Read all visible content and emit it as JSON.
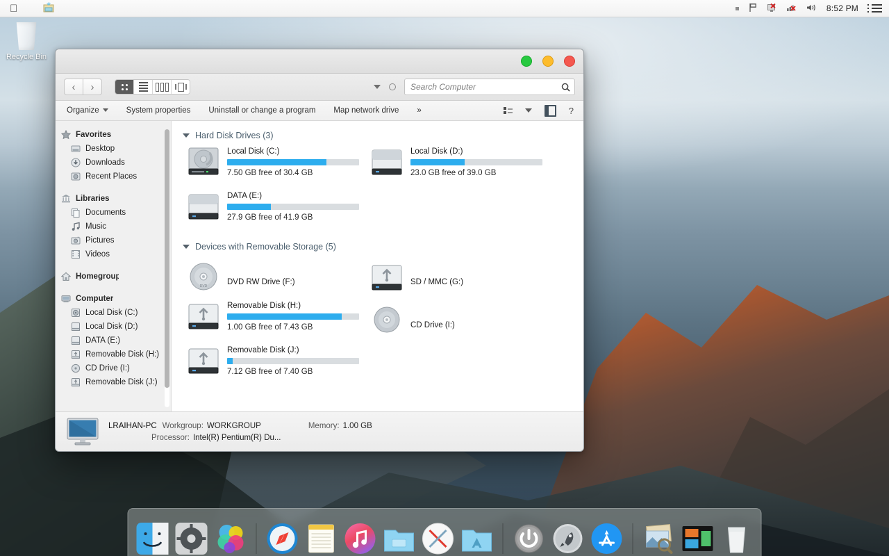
{
  "menubar": {
    "apple_icon": "apple-logo",
    "app_icon": "folder-app-icon",
    "status_icons": [
      "small-square-icon",
      "flag-icon",
      "action-center-alert-icon",
      "network-disconnected-icon",
      "volume-icon"
    ],
    "clock": "8:52 PM",
    "menu_icon": "hamburger-menu-icon"
  },
  "desktop": {
    "icons": [
      {
        "label": "Recycle Bin",
        "icon": "trash-can-icon"
      }
    ]
  },
  "window": {
    "traffic_lights": [
      {
        "name": "maximize",
        "color": "#28c941"
      },
      {
        "name": "minimize",
        "color": "#fdbc2c"
      },
      {
        "name": "close",
        "color": "#f4584f"
      }
    ],
    "nav": {
      "back_label": "‹",
      "forward_label": "›",
      "views": [
        {
          "name": "icon-view",
          "icon": "grid-icon",
          "active": true
        },
        {
          "name": "list-view",
          "icon": "list-icon",
          "active": false
        },
        {
          "name": "column-view",
          "icon": "columns-icon",
          "active": false
        },
        {
          "name": "gallery-view",
          "icon": "coverflow-icon",
          "active": false
        }
      ],
      "arrange_icon": "caret-down-icon",
      "action_icon": "circle-icon"
    },
    "search": {
      "placeholder": "Search Computer",
      "value": "",
      "icon": "search-icon"
    },
    "commandbar": {
      "items": [
        {
          "label": "Organize",
          "has_caret": true
        },
        {
          "label": "System properties",
          "has_caret": false
        },
        {
          "label": "Uninstall or change a program",
          "has_caret": false
        },
        {
          "label": "Map network drive",
          "has_caret": false
        },
        {
          "label": "»",
          "has_caret": false
        }
      ],
      "right_icons": [
        {
          "name": "change-view-icon"
        },
        {
          "name": "caret-down-icon"
        },
        {
          "name": "preview-pane-icon"
        },
        {
          "name": "help-icon",
          "glyph": "?"
        }
      ]
    },
    "sidebar": {
      "groups": [
        {
          "header": {
            "label": "Favorites",
            "icon": "star-icon"
          },
          "items": [
            {
              "label": "Desktop",
              "icon": "desktop-icon"
            },
            {
              "label": "Downloads",
              "icon": "downloads-icon"
            },
            {
              "label": "Recent Places",
              "icon": "recent-places-icon"
            }
          ]
        },
        {
          "header": {
            "label": "Libraries",
            "icon": "library-icon"
          },
          "items": [
            {
              "label": "Documents",
              "icon": "documents-icon"
            },
            {
              "label": "Music",
              "icon": "music-icon"
            },
            {
              "label": "Pictures",
              "icon": "pictures-icon"
            },
            {
              "label": "Videos",
              "icon": "videos-icon"
            }
          ]
        },
        {
          "header": {
            "label": "Homegroup",
            "icon": "home-icon"
          },
          "items": []
        },
        {
          "header": {
            "label": "Computer",
            "icon": "computer-icon"
          },
          "items": [
            {
              "label": "Local Disk (C:)",
              "icon": "hard-disk-icon"
            },
            {
              "label": "Local Disk (D:)",
              "icon": "drive-icon"
            },
            {
              "label": "DATA (E:)",
              "icon": "drive-icon"
            },
            {
              "label": "Removable Disk (H:)",
              "icon": "usb-drive-icon"
            },
            {
              "label": "CD Drive (I:)",
              "icon": "cd-drive-icon"
            },
            {
              "label": "Removable Disk (J:)",
              "icon": "usb-drive-icon"
            }
          ]
        }
      ]
    },
    "content": {
      "groups": [
        {
          "title": "Hard Disk Drives (3)",
          "drives": [
            {
              "name": "Local Disk (C:)",
              "free_text": "7.50 GB free of 30.4 GB",
              "used_pct": 75,
              "icon": "hard-disk-platter-icon",
              "has_bar": true
            },
            {
              "name": "Local Disk (D:)",
              "free_text": "23.0 GB free of 39.0 GB",
              "used_pct": 41,
              "icon": "drive-box-icon",
              "has_bar": true
            },
            {
              "name": "DATA (E:)",
              "free_text": "27.9 GB free of 41.9 GB",
              "used_pct": 33,
              "icon": "drive-box-icon",
              "has_bar": true
            }
          ]
        },
        {
          "title": "Devices with Removable Storage (5)",
          "drives": [
            {
              "name": "DVD RW Drive (F:)",
              "free_text": "",
              "used_pct": 0,
              "icon": "dvd-disc-icon",
              "has_bar": false
            },
            {
              "name": "SD / MMC (G:)",
              "free_text": "",
              "used_pct": 0,
              "icon": "usb-drive-box-icon",
              "has_bar": false
            },
            {
              "name": "Removable Disk (H:)",
              "free_text": "1.00 GB free of 7.43 GB",
              "used_pct": 87,
              "icon": "usb-drive-box-icon",
              "has_bar": true
            },
            {
              "name": "CD Drive (I:)",
              "free_text": "",
              "used_pct": 0,
              "icon": "cd-disc-icon",
              "has_bar": false
            },
            {
              "name": "Removable Disk (J:)",
              "free_text": "7.12 GB free of 7.40 GB",
              "used_pct": 4,
              "icon": "usb-drive-box-icon",
              "has_bar": true
            }
          ]
        }
      ]
    },
    "statusbar": {
      "computer_icon": "imac-icon",
      "computer_name": "LRAIHAN-PC",
      "workgroup_key": "Workgroup:",
      "workgroup_value": "WORKGROUP",
      "memory_key": "Memory:",
      "memory_value": "1.00 GB",
      "processor_key": "Processor:",
      "processor_value": "Intel(R) Pentium(R) Du..."
    }
  },
  "dock": {
    "items": [
      {
        "name": "finder",
        "icon": "finder-icon"
      },
      {
        "name": "system-preferences",
        "icon": "gear-icon"
      },
      {
        "name": "color-bubbles-app",
        "icon": "color-bubbles-icon"
      },
      {
        "name": "separator-1",
        "icon": "separator"
      },
      {
        "name": "safari",
        "icon": "compass-icon"
      },
      {
        "name": "notes",
        "icon": "notepad-icon"
      },
      {
        "name": "itunes",
        "icon": "music-note-icon"
      },
      {
        "name": "blue-folder",
        "icon": "folder-icon"
      },
      {
        "name": "xquartz",
        "icon": "x-icon"
      },
      {
        "name": "applications-folder",
        "icon": "app-folder-icon"
      },
      {
        "name": "separator-2",
        "icon": "separator"
      },
      {
        "name": "shutdown",
        "icon": "power-icon"
      },
      {
        "name": "launchpad",
        "icon": "rocket-icon"
      },
      {
        "name": "app-store",
        "icon": "app-store-icon"
      },
      {
        "name": "separator-3",
        "icon": "separator"
      },
      {
        "name": "preview",
        "icon": "photos-icon"
      },
      {
        "name": "mission-control",
        "icon": "mission-control-icon"
      },
      {
        "name": "trash",
        "icon": "trash-icon"
      }
    ]
  },
  "colors": {
    "progress_fill": "#2dadee",
    "progress_track": "#d9dde0",
    "group_title": "#4b5f6e",
    "window_chrome": "#ececec"
  }
}
